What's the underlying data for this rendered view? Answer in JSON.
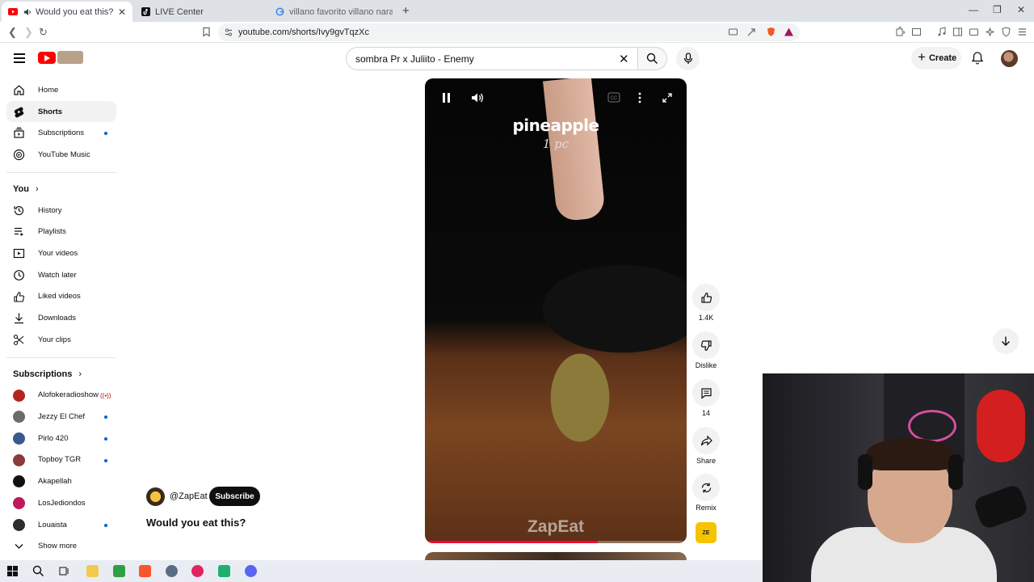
{
  "browser": {
    "tabs": [
      {
        "title": "Would you eat this? - YouTube",
        "active": true,
        "favicon": "youtube-icon",
        "audio": true
      },
      {
        "title": "LIVE Center",
        "active": false,
        "favicon": "tiktok-icon"
      },
      {
        "title": "villano favorito villano naranja - Google",
        "active": false,
        "favicon": "google-icon"
      }
    ],
    "url": "youtube.com/shorts/Ivy9gvTqzXc"
  },
  "masthead": {
    "search_value": "sombra Pr x Juliito - Enemy",
    "create_label": "Create"
  },
  "sidebar": {
    "main": [
      {
        "label": "Home",
        "icon": "home-icon"
      },
      {
        "label": "Shorts",
        "icon": "shorts-icon",
        "active": true
      },
      {
        "label": "Subscriptions",
        "icon": "subscriptions-icon",
        "dot": true
      },
      {
        "label": "YouTube Music",
        "icon": "youtube-music-icon"
      }
    ],
    "you_heading": "You",
    "you": [
      {
        "label": "History",
        "icon": "history-icon"
      },
      {
        "label": "Playlists",
        "icon": "playlists-icon"
      },
      {
        "label": "Your videos",
        "icon": "your-videos-icon"
      },
      {
        "label": "Watch later",
        "icon": "watch-later-icon"
      },
      {
        "label": "Liked videos",
        "icon": "liked-videos-icon"
      },
      {
        "label": "Downloads",
        "icon": "downloads-icon"
      },
      {
        "label": "Your clips",
        "icon": "scissors-icon"
      }
    ],
    "subscriptions_heading": "Subscriptions",
    "subscriptions": [
      {
        "label": "Alofokeradioshow",
        "live": true,
        "color": "#b3261e"
      },
      {
        "label": "Jezzy El Chef",
        "dot": true,
        "color": "#6b6b6b"
      },
      {
        "label": "Pirlo 420",
        "dot": true,
        "color": "#3a5a8c"
      },
      {
        "label": "Topboy TGR",
        "dot": true,
        "color": "#8c3a3a"
      },
      {
        "label": "Akapellah",
        "color": "#111111"
      },
      {
        "label": "LosJediondos",
        "color": "#c2185b"
      },
      {
        "label": "Louaista",
        "dot": true,
        "color": "#2e2e2e"
      }
    ],
    "show_more": "Show more"
  },
  "player": {
    "overlay_title": "pineapple",
    "overlay_sub": "1 pc",
    "watermark": "ZapEat",
    "progress": 0.66
  },
  "actions": {
    "like_count": "1.4K",
    "dislike_label": "Dislike",
    "comment_count": "14",
    "share_label": "Share",
    "remix_label": "Remix"
  },
  "channel": {
    "handle": "@ZapEat",
    "subscribe_label": "Subscribe",
    "video_title": "Would you eat this?"
  },
  "colors": {
    "brand_red": "#ff0000",
    "accent_blue": "#065fd4",
    "progress_red": "#ff0033"
  }
}
